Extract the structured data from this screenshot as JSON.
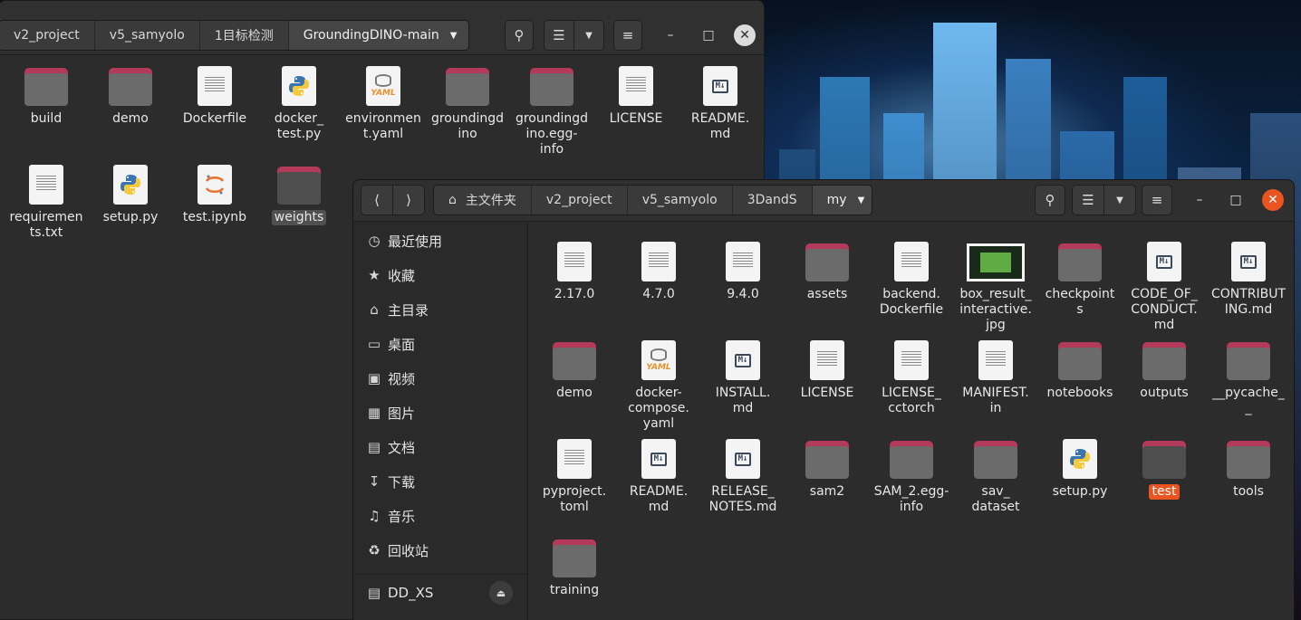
{
  "back_window": {
    "path": [
      "v2_project",
      "v5_samyolo",
      "1目标检测",
      "GroundingDINO-main"
    ],
    "items": [
      {
        "name": "build",
        "type": "folder"
      },
      {
        "name": "demo",
        "type": "folder"
      },
      {
        "name": "Dockerfile",
        "type": "doc"
      },
      {
        "name": "docker_\ntest.py",
        "type": "py"
      },
      {
        "name": "environmen\nt.yaml",
        "type": "yaml"
      },
      {
        "name": "groundingd\nino",
        "type": "folder"
      },
      {
        "name": "groundingd\nino.egg-\ninfo",
        "type": "folder"
      },
      {
        "name": "LICENSE",
        "type": "doc"
      },
      {
        "name": "README.\nmd",
        "type": "md"
      },
      {
        "name": "requiremen\nts.txt",
        "type": "doc"
      },
      {
        "name": "setup.py",
        "type": "py"
      },
      {
        "name": "test.ipynb",
        "type": "jupyter"
      },
      {
        "name": "weights",
        "type": "folder",
        "selected": true
      }
    ]
  },
  "front_window": {
    "path_home": "主文件夹",
    "path": [
      "v2_project",
      "v5_samyolo",
      "3DandS",
      "my"
    ],
    "sidebar": [
      {
        "label": "最近使用",
        "icon": "clock-icon"
      },
      {
        "label": "收藏",
        "icon": "star-icon"
      },
      {
        "label": "主目录",
        "icon": "home-icon"
      },
      {
        "label": "桌面",
        "icon": "desktop-icon"
      },
      {
        "label": "视频",
        "icon": "video-icon"
      },
      {
        "label": "图片",
        "icon": "image-icon"
      },
      {
        "label": "文档",
        "icon": "document-icon"
      },
      {
        "label": "下载",
        "icon": "download-icon"
      },
      {
        "label": "音乐",
        "icon": "music-icon"
      },
      {
        "label": "回收站",
        "icon": "trash-icon"
      }
    ],
    "drive": {
      "label": "DD_XS",
      "icon": "drive-icon"
    },
    "items": [
      {
        "name": "2.17.0",
        "type": "doc"
      },
      {
        "name": "4.7.0",
        "type": "doc"
      },
      {
        "name": "9.4.0",
        "type": "doc"
      },
      {
        "name": "assets",
        "type": "folder"
      },
      {
        "name": "backend.\nDockerfile",
        "type": "doc"
      },
      {
        "name": "box_result_\ninteractive.\njpg",
        "type": "image"
      },
      {
        "name": "checkpoint\ns",
        "type": "folder"
      },
      {
        "name": "CODE_OF_\nCONDUCT.\nmd",
        "type": "md"
      },
      {
        "name": "CONTRIBUT\nING.md",
        "type": "md"
      },
      {
        "name": "demo",
        "type": "folder"
      },
      {
        "name": "docker-\ncompose.\nyaml",
        "type": "yaml"
      },
      {
        "name": "INSTALL.\nmd",
        "type": "md"
      },
      {
        "name": "LICENSE",
        "type": "doc"
      },
      {
        "name": "LICENSE_\ncctorch",
        "type": "doc"
      },
      {
        "name": "MANIFEST.\nin",
        "type": "doc"
      },
      {
        "name": "notebooks",
        "type": "folder"
      },
      {
        "name": "outputs",
        "type": "folder"
      },
      {
        "name": "__pycache_\n_",
        "type": "folder"
      },
      {
        "name": "pyproject.\ntoml",
        "type": "doc"
      },
      {
        "name": "README.\nmd",
        "type": "md"
      },
      {
        "name": "RELEASE_\nNOTES.md",
        "type": "md"
      },
      {
        "name": "sam2",
        "type": "folder"
      },
      {
        "name": "SAM_2.egg-\ninfo",
        "type": "folder"
      },
      {
        "name": "sav_\ndataset",
        "type": "folder"
      },
      {
        "name": "setup.py",
        "type": "py"
      },
      {
        "name": "test",
        "type": "folder",
        "selected": true
      },
      {
        "name": "tools",
        "type": "folder"
      },
      {
        "name": "training",
        "type": "folder"
      }
    ]
  },
  "colors": {
    "accent": "#e95420",
    "folder_tab": "#b33a5a",
    "folder_body": "#6b6b6b",
    "window_bg": "#2c2c2c"
  }
}
